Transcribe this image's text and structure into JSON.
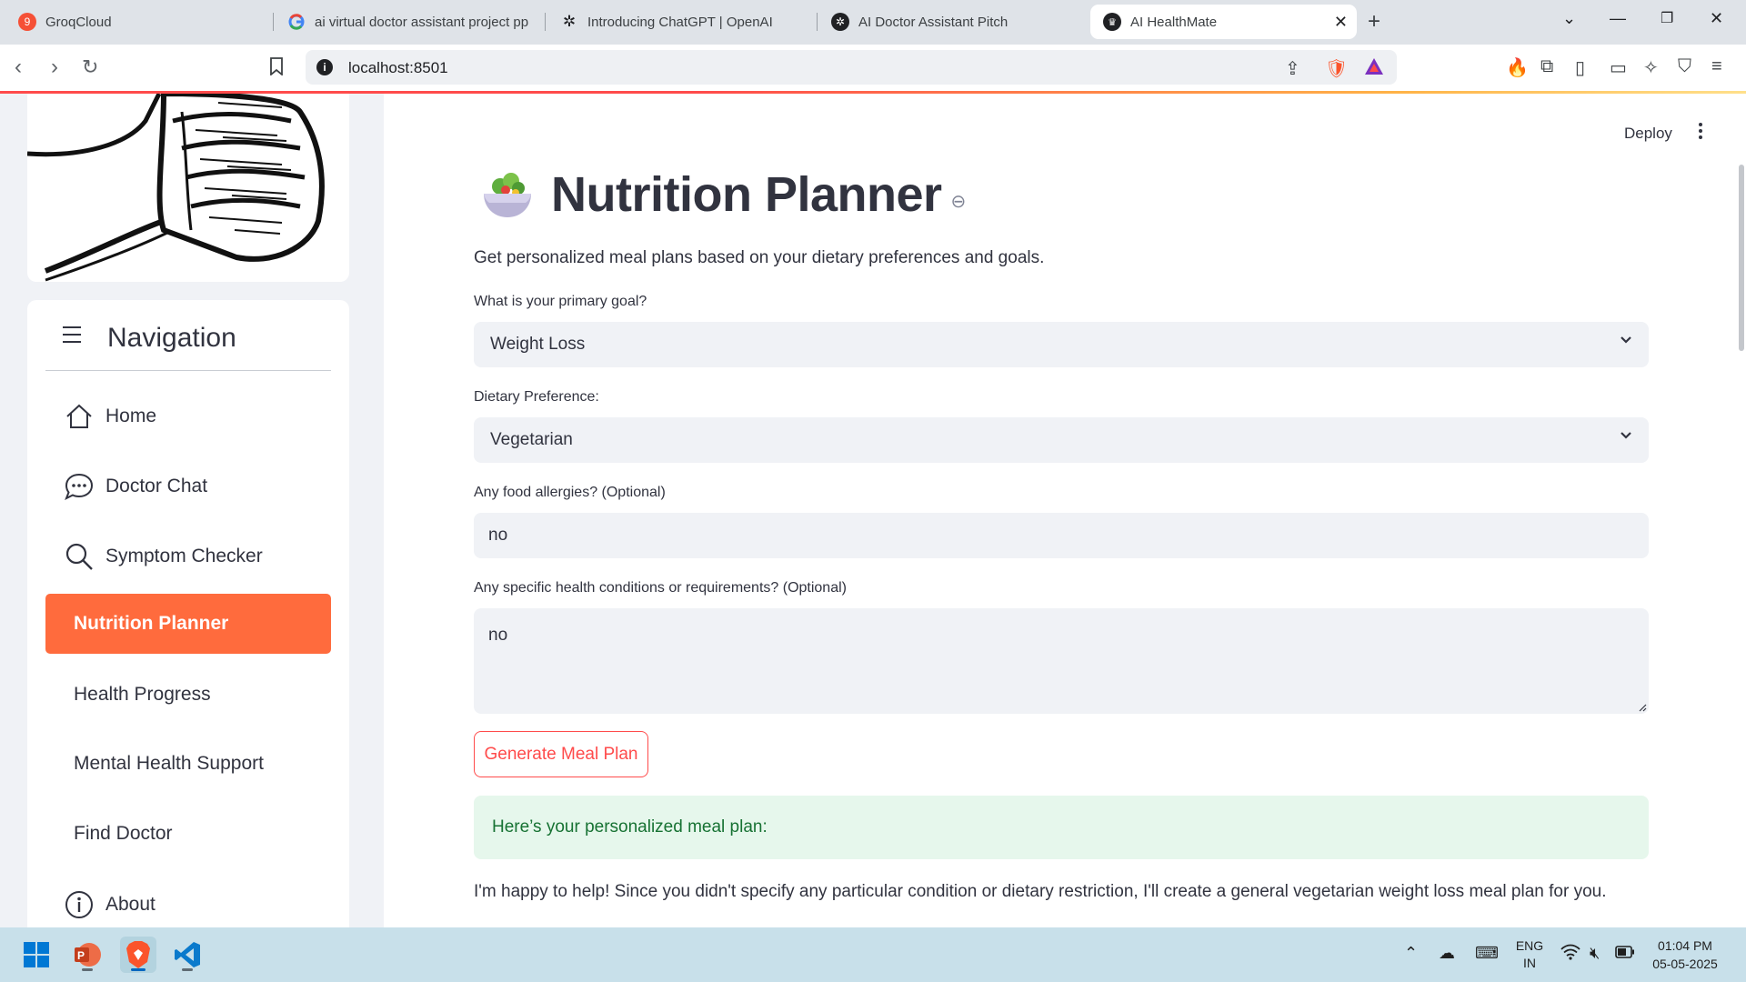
{
  "browser": {
    "tabs": [
      {
        "title": "GroqCloud",
        "favicon": "groq-icon",
        "badge": "9"
      },
      {
        "title": "ai virtual doctor assistant project pp",
        "favicon": "google-icon"
      },
      {
        "title": "Introducing ChatGPT | OpenAI",
        "favicon": "openai-icon"
      },
      {
        "title": "AI Doctor Assistant Pitch",
        "favicon": "chatgpt-icon"
      },
      {
        "title": "AI HealthMate",
        "favicon": "streamlit-crown-icon",
        "active": true
      }
    ],
    "url": "localhost:8501"
  },
  "sidebar": {
    "nav_title": "Navigation",
    "items": [
      {
        "label": "Home",
        "icon": "house-icon"
      },
      {
        "label": "Doctor Chat",
        "icon": "chat-bubble-icon"
      },
      {
        "label": "Symptom Checker",
        "icon": "magnifier-icon"
      },
      {
        "label": "Nutrition Planner",
        "active": true
      },
      {
        "label": "Health Progress"
      },
      {
        "label": "Mental Health Support"
      },
      {
        "label": "Find Doctor"
      },
      {
        "label": "About",
        "icon": "info-icon"
      }
    ]
  },
  "header": {
    "deploy_label": "Deploy"
  },
  "main": {
    "title": "Nutrition Planner",
    "description": "Get personalized meal plans based on your dietary preferences and goals.",
    "goal": {
      "label": "What is your primary goal?",
      "value": "Weight Loss"
    },
    "diet": {
      "label": "Dietary Preference:",
      "value": "Vegetarian"
    },
    "allergies": {
      "label": "Any food allergies? (Optional)",
      "value": "no"
    },
    "conditions": {
      "label": "Any specific health conditions or requirements? (Optional)",
      "value": "no"
    },
    "generate_label": "Generate Meal Plan",
    "success_text": "Here’s your personalized meal plan:",
    "response_text": "I'm happy to help! Since you didn't specify any particular condition or dietary restriction, I'll create a general vegetarian weight loss meal plan for you."
  },
  "taskbar": {
    "language": "ENG",
    "region": "IN",
    "time": "01:04 PM",
    "date": "05-05-2025"
  },
  "colors": {
    "accent": "#ff4b4b",
    "active_nav": "#ff6b3d",
    "success_bg": "#e6f7ec",
    "success_text": "#177233"
  }
}
